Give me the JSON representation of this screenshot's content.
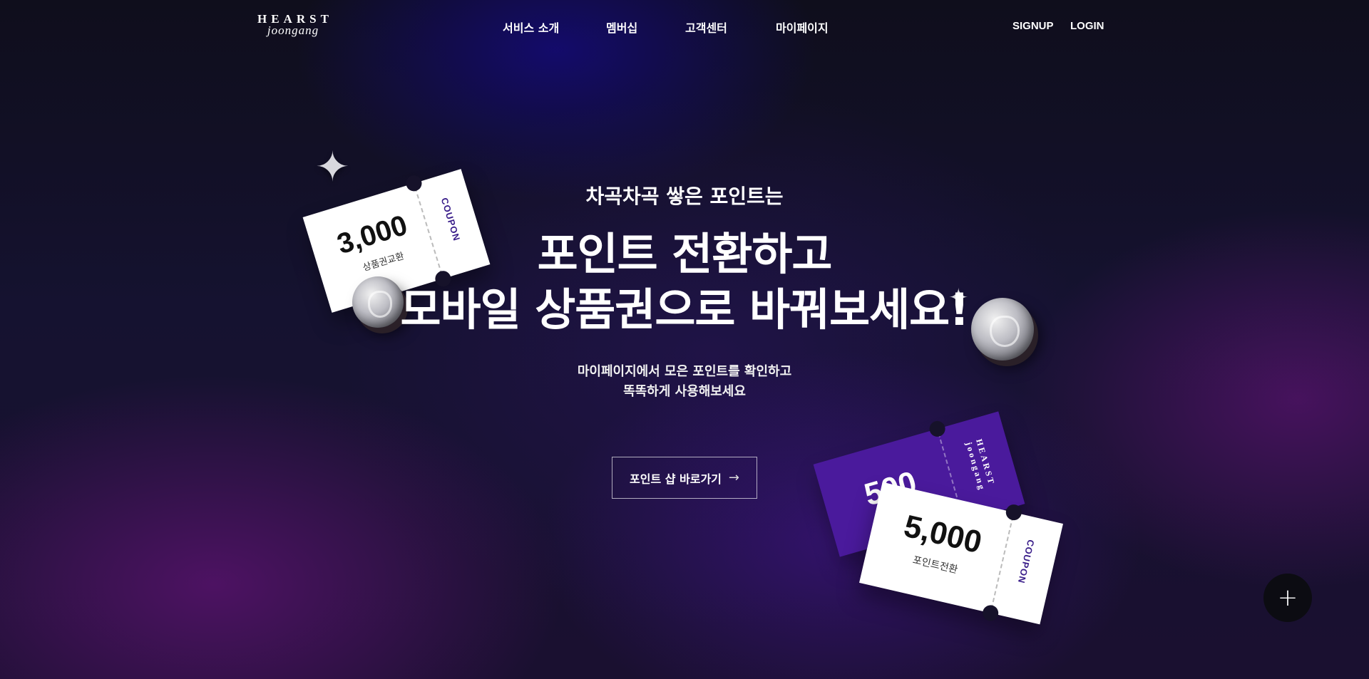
{
  "header": {
    "logo_line1": "HEARST",
    "logo_line2": "joongang",
    "nav": [
      "서비스 소개",
      "멤버십",
      "고객센터",
      "마이페이지"
    ],
    "signup": "SIGNUP",
    "login": "LOGIN"
  },
  "hero": {
    "kicker": "차곡차곡 쌓은 포인트는",
    "title_line1": "포인트 전환하고",
    "title_line2": "모바일 상품권으로 바꿔보세요!",
    "desc_line1": "마이페이지에서 모은 포인트를 확인하고",
    "desc_line2": "똑똑하게 사용해보세요",
    "cta_label": "포인트 샵 바로가기",
    "cta_icon": "arrow-right-icon"
  },
  "decor": {
    "coupon1": {
      "amount": "3,000",
      "label": "상품권교환",
      "tag": "COUPON"
    },
    "coupon2": {
      "amount": "500",
      "brand": "HEARST joongang"
    },
    "coupon3": {
      "amount": "5,000",
      "label": "포인트전환",
      "tag": "COUPON"
    }
  },
  "fab": {
    "icon": "plus-icon",
    "label": "+"
  },
  "colors": {
    "accent_purple": "#4a1a9c",
    "coupon_text": "#3a1e8a"
  }
}
